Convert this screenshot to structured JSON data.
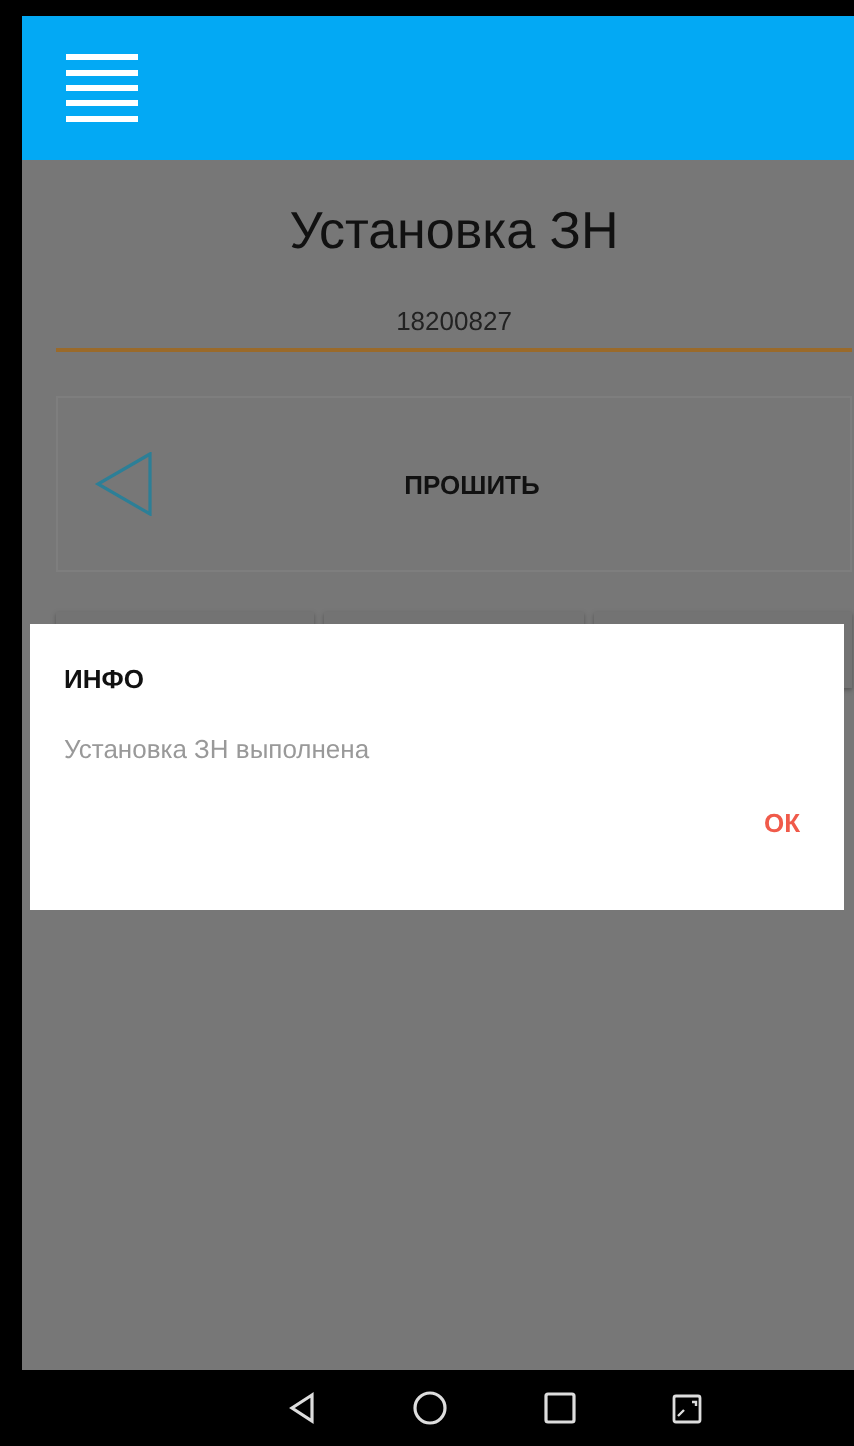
{
  "screen": {
    "title": "Установка ЗН",
    "serial_field": {
      "value": "18200827"
    },
    "flash_button": {
      "label": "ПРОШИТЬ"
    }
  },
  "dialog": {
    "title": "ИНФО",
    "message": "Установка ЗН выполнена",
    "buttons": [
      "ОК"
    ]
  }
}
